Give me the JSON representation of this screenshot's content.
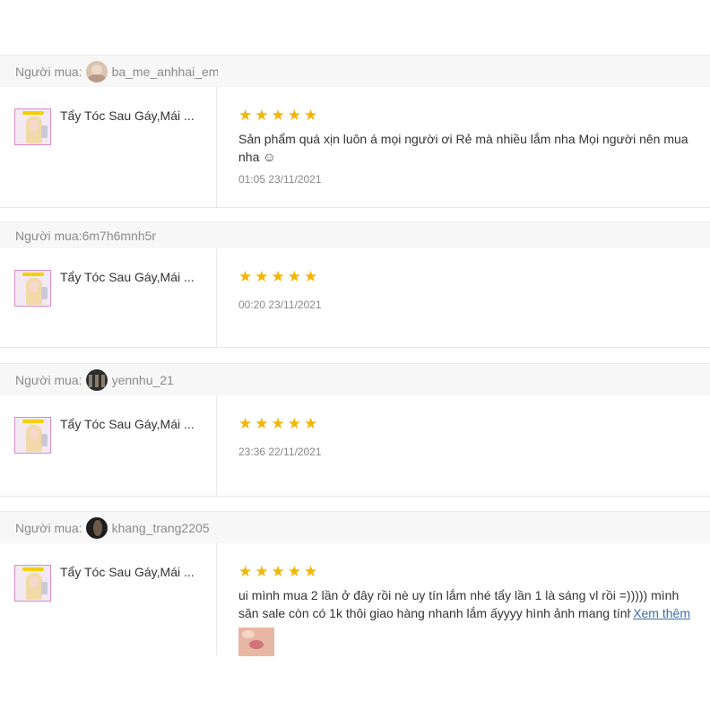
{
  "colors": {
    "star": "#f5b400",
    "link": "#3f6ea6",
    "buyer_bar": "#f7f7f7"
  },
  "buyer_label": "Người mua:",
  "reviews": [
    {
      "buyer_label": "Người mua:",
      "username": "ba_me_anhhai_em",
      "has_avatar": true,
      "product_name": "Tẩy Tóc Sau Gáy,Mái ...",
      "rating": 5,
      "comment": "Sản phẩm quá xịn luôn á mọi người ơi Rẻ mà nhiều lắm nha Mọi người nên mua nha ☺",
      "timestamp": "01:05 23/11/2021"
    },
    {
      "buyer_label": "Người mua:",
      "username": "6m7h6mnh5r",
      "has_avatar": false,
      "product_name": "Tẩy Tóc Sau Gáy,Mái ...",
      "rating": 5,
      "comment": "",
      "timestamp": "00:20 23/11/2021"
    },
    {
      "buyer_label": "Người mua:",
      "username": "yennhu_21",
      "has_avatar": true,
      "product_name": "Tẩy Tóc Sau Gáy,Mái ...",
      "rating": 5,
      "comment": "",
      "timestamp": "23:36 22/11/2021"
    },
    {
      "buyer_label": "Người mua:",
      "username": "khang_trang2205",
      "has_avatar": true,
      "product_name": "Tẩy Tóc Sau Gáy,Mái ...",
      "rating": 5,
      "comment": "ui mình mua 2 lần ở đây rồi nè uy tín lắm nhé tẩy lần 1 là sáng vl rồi =))))) mình săn sale còn có 1k thôi giao hàng nhanh lắm ấyyyy hình ảnh mang tính...",
      "more_label": "Xem thêm",
      "timestamp": ""
    }
  ]
}
